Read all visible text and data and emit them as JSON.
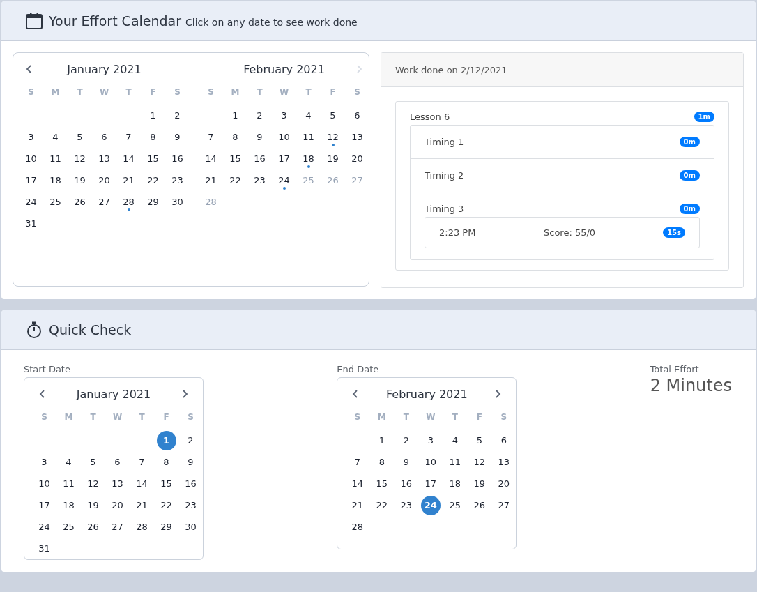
{
  "effort_calendar": {
    "title": "Your Effort Calendar",
    "subtitle": "Click on any date to see work done",
    "months": [
      {
        "title": "January 2021",
        "prev": {
          "disabled": false
        },
        "weekdays": [
          "S",
          "M",
          "T",
          "W",
          "T",
          "F",
          "S"
        ],
        "weeks": [
          [
            {
              "kind": "empty"
            },
            {
              "kind": "empty"
            },
            {
              "kind": "empty"
            },
            {
              "kind": "empty"
            },
            {
              "kind": "empty"
            },
            {
              "kind": "day",
              "label": "1",
              "disabled": false,
              "marked": false
            },
            {
              "kind": "day",
              "label": "2",
              "disabled": false,
              "marked": false
            }
          ],
          [
            {
              "kind": "day",
              "label": "3",
              "disabled": false,
              "marked": false
            },
            {
              "kind": "day",
              "label": "4",
              "disabled": false,
              "marked": false
            },
            {
              "kind": "day",
              "label": "5",
              "disabled": false,
              "marked": false
            },
            {
              "kind": "day",
              "label": "6",
              "disabled": false,
              "marked": false
            },
            {
              "kind": "day",
              "label": "7",
              "disabled": false,
              "marked": false
            },
            {
              "kind": "day",
              "label": "8",
              "disabled": false,
              "marked": false
            },
            {
              "kind": "day",
              "label": "9",
              "disabled": false,
              "marked": false
            }
          ],
          [
            {
              "kind": "day",
              "label": "10",
              "disabled": false,
              "marked": false
            },
            {
              "kind": "day",
              "label": "11",
              "disabled": false,
              "marked": false
            },
            {
              "kind": "day",
              "label": "12",
              "disabled": false,
              "marked": false
            },
            {
              "kind": "day",
              "label": "13",
              "disabled": false,
              "marked": false
            },
            {
              "kind": "day",
              "label": "14",
              "disabled": false,
              "marked": false
            },
            {
              "kind": "day",
              "label": "15",
              "disabled": false,
              "marked": false
            },
            {
              "kind": "day",
              "label": "16",
              "disabled": false,
              "marked": false
            }
          ],
          [
            {
              "kind": "day",
              "label": "17",
              "disabled": false,
              "marked": false
            },
            {
              "kind": "day",
              "label": "18",
              "disabled": false,
              "marked": false
            },
            {
              "kind": "day",
              "label": "19",
              "disabled": false,
              "marked": false
            },
            {
              "kind": "day",
              "label": "20",
              "disabled": false,
              "marked": false
            },
            {
              "kind": "day",
              "label": "21",
              "disabled": false,
              "marked": false
            },
            {
              "kind": "day",
              "label": "22",
              "disabled": false,
              "marked": false
            },
            {
              "kind": "day",
              "label": "23",
              "disabled": false,
              "marked": false
            }
          ],
          [
            {
              "kind": "day",
              "label": "24",
              "disabled": false,
              "marked": false
            },
            {
              "kind": "day",
              "label": "25",
              "disabled": false,
              "marked": false
            },
            {
              "kind": "day",
              "label": "26",
              "disabled": false,
              "marked": false
            },
            {
              "kind": "day",
              "label": "27",
              "disabled": false,
              "marked": false
            },
            {
              "kind": "day",
              "label": "28",
              "disabled": false,
              "marked": true
            },
            {
              "kind": "day",
              "label": "29",
              "disabled": false,
              "marked": false
            },
            {
              "kind": "day",
              "label": "30",
              "disabled": false,
              "marked": false
            }
          ],
          [
            {
              "kind": "day",
              "label": "31",
              "disabled": false,
              "marked": false
            }
          ]
        ]
      },
      {
        "title": "February 2021",
        "next": {
          "disabled": true
        },
        "weekdays": [
          "S",
          "M",
          "T",
          "W",
          "T",
          "F",
          "S"
        ],
        "weeks": [
          [
            {
              "kind": "empty"
            },
            {
              "kind": "day",
              "label": "1",
              "disabled": false,
              "marked": false
            },
            {
              "kind": "day",
              "label": "2",
              "disabled": false,
              "marked": false
            },
            {
              "kind": "day",
              "label": "3",
              "disabled": false,
              "marked": false
            },
            {
              "kind": "day",
              "label": "4",
              "disabled": false,
              "marked": false
            },
            {
              "kind": "day",
              "label": "5",
              "disabled": false,
              "marked": false
            },
            {
              "kind": "day",
              "label": "6",
              "disabled": false,
              "marked": false
            }
          ],
          [
            {
              "kind": "day",
              "label": "7",
              "disabled": false,
              "marked": false
            },
            {
              "kind": "day",
              "label": "8",
              "disabled": false,
              "marked": false
            },
            {
              "kind": "day",
              "label": "9",
              "disabled": false,
              "marked": false
            },
            {
              "kind": "day",
              "label": "10",
              "disabled": false,
              "marked": false
            },
            {
              "kind": "day",
              "label": "11",
              "disabled": false,
              "marked": false
            },
            {
              "kind": "day",
              "label": "12",
              "disabled": false,
              "marked": true
            },
            {
              "kind": "day",
              "label": "13",
              "disabled": false,
              "marked": false
            }
          ],
          [
            {
              "kind": "day",
              "label": "14",
              "disabled": false,
              "marked": false
            },
            {
              "kind": "day",
              "label": "15",
              "disabled": false,
              "marked": false
            },
            {
              "kind": "day",
              "label": "16",
              "disabled": false,
              "marked": false
            },
            {
              "kind": "day",
              "label": "17",
              "disabled": false,
              "marked": false
            },
            {
              "kind": "day",
              "label": "18",
              "disabled": false,
              "marked": true
            },
            {
              "kind": "day",
              "label": "19",
              "disabled": false,
              "marked": false
            },
            {
              "kind": "day",
              "label": "20",
              "disabled": false,
              "marked": false
            }
          ],
          [
            {
              "kind": "day",
              "label": "21",
              "disabled": false,
              "marked": false
            },
            {
              "kind": "day",
              "label": "22",
              "disabled": false,
              "marked": false
            },
            {
              "kind": "day",
              "label": "23",
              "disabled": false,
              "marked": false
            },
            {
              "kind": "day",
              "label": "24",
              "disabled": false,
              "marked": true
            },
            {
              "kind": "day",
              "label": "25",
              "disabled": true,
              "marked": false
            },
            {
              "kind": "day",
              "label": "26",
              "disabled": true,
              "marked": false
            },
            {
              "kind": "day",
              "label": "27",
              "disabled": true,
              "marked": false
            }
          ],
          [
            {
              "kind": "day",
              "label": "28",
              "disabled": true,
              "marked": false
            }
          ]
        ]
      }
    ],
    "work_panel": {
      "title": "Work done on 2/12/2021",
      "lessons": [
        {
          "name": "Lesson 6",
          "duration": "1m",
          "timings": [
            {
              "name": "Timing 1",
              "duration": "0m"
            },
            {
              "name": "Timing 2",
              "duration": "0m"
            },
            {
              "name": "Timing 3",
              "duration": "0m",
              "attempts": [
                {
                  "time": "2:23 PM",
                  "score": "Score: 55/0",
                  "duration": "15s"
                }
              ]
            }
          ]
        }
      ]
    }
  },
  "quick_check": {
    "title": "Quick Check",
    "pickers": [
      {
        "label": "Start Date",
        "title": "January 2021",
        "weekdays": [
          "S",
          "M",
          "T",
          "W",
          "T",
          "F",
          "S"
        ],
        "weeks": [
          [
            {
              "kind": "empty"
            },
            {
              "kind": "empty"
            },
            {
              "kind": "empty"
            },
            {
              "kind": "empty"
            },
            {
              "kind": "empty"
            },
            {
              "kind": "day",
              "label": "1",
              "selected": true
            },
            {
              "kind": "day",
              "label": "2",
              "selected": false
            }
          ],
          [
            {
              "kind": "day",
              "label": "3",
              "selected": false
            },
            {
              "kind": "day",
              "label": "4",
              "selected": false
            },
            {
              "kind": "day",
              "label": "5",
              "selected": false
            },
            {
              "kind": "day",
              "label": "6",
              "selected": false
            },
            {
              "kind": "day",
              "label": "7",
              "selected": false
            },
            {
              "kind": "day",
              "label": "8",
              "selected": false
            },
            {
              "kind": "day",
              "label": "9",
              "selected": false
            }
          ],
          [
            {
              "kind": "day",
              "label": "10",
              "selected": false
            },
            {
              "kind": "day",
              "label": "11",
              "selected": false
            },
            {
              "kind": "day",
              "label": "12",
              "selected": false
            },
            {
              "kind": "day",
              "label": "13",
              "selected": false
            },
            {
              "kind": "day",
              "label": "14",
              "selected": false
            },
            {
              "kind": "day",
              "label": "15",
              "selected": false
            },
            {
              "kind": "day",
              "label": "16",
              "selected": false
            }
          ],
          [
            {
              "kind": "day",
              "label": "17",
              "selected": false
            },
            {
              "kind": "day",
              "label": "18",
              "selected": false
            },
            {
              "kind": "day",
              "label": "19",
              "selected": false
            },
            {
              "kind": "day",
              "label": "20",
              "selected": false
            },
            {
              "kind": "day",
              "label": "21",
              "selected": false
            },
            {
              "kind": "day",
              "label": "22",
              "selected": false
            },
            {
              "kind": "day",
              "label": "23",
              "selected": false
            }
          ],
          [
            {
              "kind": "day",
              "label": "24",
              "selected": false
            },
            {
              "kind": "day",
              "label": "25",
              "selected": false
            },
            {
              "kind": "day",
              "label": "26",
              "selected": false
            },
            {
              "kind": "day",
              "label": "27",
              "selected": false
            },
            {
              "kind": "day",
              "label": "28",
              "selected": false
            },
            {
              "kind": "day",
              "label": "29",
              "selected": false
            },
            {
              "kind": "day",
              "label": "30",
              "selected": false
            }
          ],
          [
            {
              "kind": "day",
              "label": "31",
              "selected": false
            }
          ]
        ]
      },
      {
        "label": "End Date",
        "title": "February 2021",
        "weekdays": [
          "S",
          "M",
          "T",
          "W",
          "T",
          "F",
          "S"
        ],
        "weeks": [
          [
            {
              "kind": "empty"
            },
            {
              "kind": "day",
              "label": "1",
              "selected": false
            },
            {
              "kind": "day",
              "label": "2",
              "selected": false
            },
            {
              "kind": "day",
              "label": "3",
              "selected": false
            },
            {
              "kind": "day",
              "label": "4",
              "selected": false
            },
            {
              "kind": "day",
              "label": "5",
              "selected": false
            },
            {
              "kind": "day",
              "label": "6",
              "selected": false
            }
          ],
          [
            {
              "kind": "day",
              "label": "7",
              "selected": false
            },
            {
              "kind": "day",
              "label": "8",
              "selected": false
            },
            {
              "kind": "day",
              "label": "9",
              "selected": false
            },
            {
              "kind": "day",
              "label": "10",
              "selected": false
            },
            {
              "kind": "day",
              "label": "11",
              "selected": false
            },
            {
              "kind": "day",
              "label": "12",
              "selected": false
            },
            {
              "kind": "day",
              "label": "13",
              "selected": false
            }
          ],
          [
            {
              "kind": "day",
              "label": "14",
              "selected": false
            },
            {
              "kind": "day",
              "label": "15",
              "selected": false
            },
            {
              "kind": "day",
              "label": "16",
              "selected": false
            },
            {
              "kind": "day",
              "label": "17",
              "selected": false
            },
            {
              "kind": "day",
              "label": "18",
              "selected": false
            },
            {
              "kind": "day",
              "label": "19",
              "selected": false
            },
            {
              "kind": "day",
              "label": "20",
              "selected": false
            }
          ],
          [
            {
              "kind": "day",
              "label": "21",
              "selected": false
            },
            {
              "kind": "day",
              "label": "22",
              "selected": false
            },
            {
              "kind": "day",
              "label": "23",
              "selected": false
            },
            {
              "kind": "day",
              "label": "24",
              "selected": true
            },
            {
              "kind": "day",
              "label": "25",
              "selected": false
            },
            {
              "kind": "day",
              "label": "26",
              "selected": false
            },
            {
              "kind": "day",
              "label": "27",
              "selected": false
            }
          ],
          [
            {
              "kind": "day",
              "label": "28",
              "selected": false
            }
          ]
        ]
      }
    ],
    "total": {
      "label": "Total Effort",
      "value": "2 Minutes"
    }
  }
}
